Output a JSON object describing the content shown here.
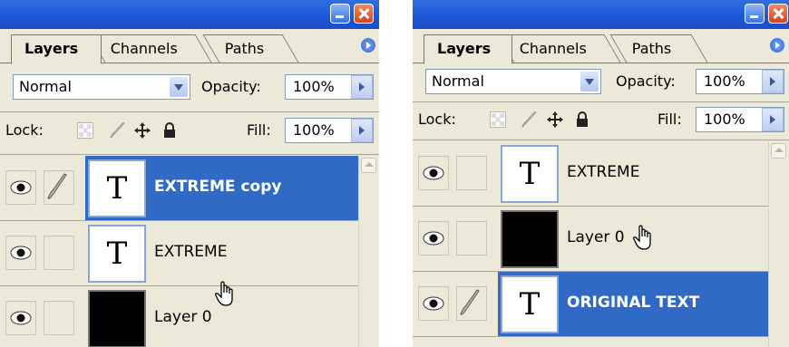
{
  "tabs": [
    "Layers",
    "Channels",
    "Paths"
  ],
  "blend_mode": "Normal",
  "opacity_label": "Opacity:",
  "opacity_value": "100%",
  "lock_label": "Lock:",
  "fill_label": "Fill:",
  "fill_value": "100%",
  "colors": {
    "selection": "#316ac5",
    "panel": "#ece9d8",
    "titlebar": "#1b55d6"
  },
  "left_panel": {
    "layers": [
      {
        "name": "EXTREME copy",
        "thumb": "T",
        "selected": true
      },
      {
        "name": "EXTREME",
        "thumb": "T",
        "selected": false
      },
      {
        "name": "Layer 0",
        "thumb": "",
        "selected": false
      }
    ]
  },
  "right_panel": {
    "layers": [
      {
        "name": "EXTREME",
        "thumb": "T",
        "selected": false
      },
      {
        "name": "Layer 0",
        "thumb": "",
        "selected": false
      },
      {
        "name": "ORIGINAL TEXT",
        "thumb": "T",
        "selected": true
      }
    ]
  }
}
